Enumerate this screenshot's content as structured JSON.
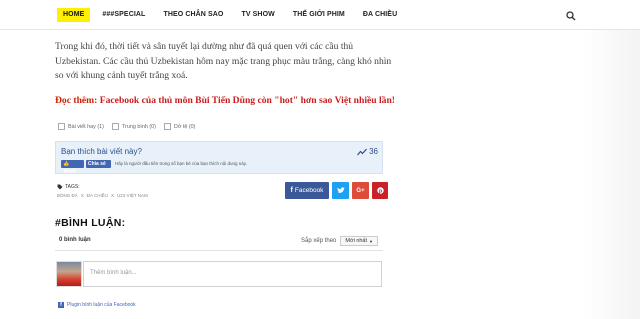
{
  "nav": {
    "items": [
      {
        "label": "HOME",
        "active": true
      },
      {
        "label": "###SPECIAL"
      },
      {
        "label": "THEO CHÂN SAO"
      },
      {
        "label": "TV SHOW"
      },
      {
        "label": "THẾ GIỚI PHIM"
      },
      {
        "label": "ĐA CHIỀU"
      }
    ],
    "search_icon": "search-icon"
  },
  "article": {
    "paragraph": "Trong khi đó, thời tiết và sân tuyết lại dường như đã quá quen với các cầu thủ Uzbekistan. Các cầu thủ Uzbekistan hôm nay mặc trang phục màu trắng, càng khó nhìn so với khung cảnh tuyết trắng xoá.",
    "readmore_lead": "Đọc thêm:",
    "readmore_link": "Facebook của thủ môn Bùi Tiến Dũng còn \"hot\" hơn sao Việt nhiều lần!"
  },
  "ratings": [
    {
      "label": "Bài viết hay (1)"
    },
    {
      "label": "Trung bình (0)"
    },
    {
      "label": "Dở tệ (0)"
    }
  ],
  "likebox": {
    "question": "Bạn thích bài viết này?",
    "count": "36",
    "like_label": "Thích",
    "share_label": "Chia sẻ",
    "note": "Hãy là người đầu tiên trong số bạn bè của bạn thích nội dung này."
  },
  "tags": {
    "label": "TAGS:",
    "items": [
      "BÓNG ĐÁ",
      "X",
      "ĐA CHIỀU",
      "X",
      "U23 VIỆT NAM"
    ]
  },
  "share": {
    "facebook": "Facebook"
  },
  "comments": {
    "title": "#BÌNH LUẬN:",
    "count": "0 bình luận",
    "sort_label": "Sắp xếp theo",
    "sort_value": "Mới nhất",
    "placeholder": "Thêm bình luận...",
    "plugin": "Plugin bình luận của Facebook"
  },
  "colors": {
    "nav_active": "#ffef00",
    "facebook": "#3b5998",
    "twitter": "#1da1f2",
    "google": "#dd4b39",
    "pinterest": "#cb2027",
    "readmore": "#cc1d1d"
  }
}
